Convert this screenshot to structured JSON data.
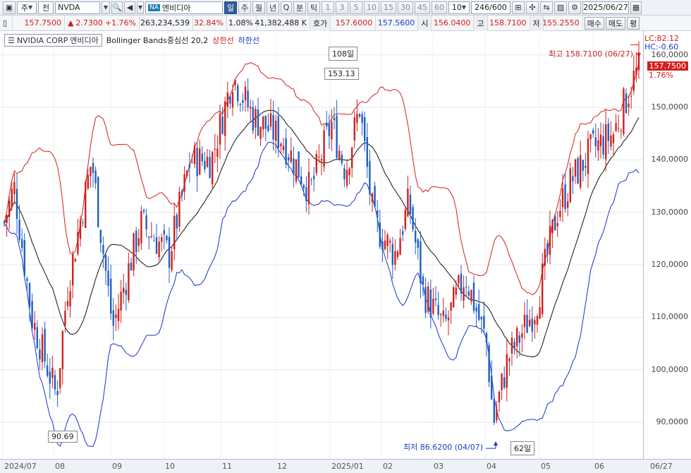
{
  "toolbar": {
    "mode_options": [
      "주",
      "전"
    ],
    "symbol": "NVDA",
    "na_badge": "NA",
    "name": "엔비디아",
    "periods": [
      "일",
      "주",
      "월",
      "년",
      "Q",
      "분",
      "틱"
    ],
    "active_period": "일",
    "intervals": [
      "1",
      "3",
      "5",
      "10",
      "15",
      "30",
      "45",
      "60",
      "10"
    ],
    "count": "246",
    "count_total": "/600",
    "date": "2025/06/27"
  },
  "quote": {
    "price": "157.7500",
    "change": "2.7300",
    "change_pct": "+1.76%",
    "volume": "263,234,539",
    "vol_ratio": "32.84%",
    "turnover_pct": "1.08%",
    "amount": "41,382,488 K",
    "bid_label": "호가",
    "bid": "157.6000",
    "ask": "157.5600",
    "open_label": "시",
    "open": "156.0400",
    "high_label": "고",
    "high": "158.7100",
    "low_label": "저",
    "low": "155.2550",
    "buy_label": "매수",
    "sell_label": "매도",
    "avg_label": "평"
  },
  "legend": {
    "company": "NVIDIA CORP",
    "name": "엔비디아",
    "indicator": "Bollinger Bands중심선 20,2",
    "upper": "상한선",
    "lower": "하한선"
  },
  "annotations": {
    "high_label": "최고 158.7100 (06/27)",
    "low_label": "최저 86.6200 (04/07)",
    "lc": "LC:82.12",
    "hc": "HC:-0.60",
    "peak_days": "108일",
    "peak_value": "153.13",
    "trough_value": "90.69",
    "low_days": "62일",
    "current_price": "157.7500",
    "current_pct": "1.76%"
  },
  "colors": {
    "up": "#d1201d",
    "down": "#1f5fc4",
    "upper_band": "#d1201d",
    "lower_band": "#1a2fd0",
    "middle_band": "#111111"
  },
  "chart_data": {
    "type": "candlestick",
    "title": "NVIDIA CORP 엔비디아",
    "indicator": "Bollinger Bands 20,2",
    "y_ticks": [
      "160,0000",
      "150,0000",
      "140,0000",
      "130,0000",
      "120,0000",
      "110,0000",
      "100,0000",
      "90,0000"
    ],
    "x_ticks": [
      "2024/07",
      "08",
      "09",
      "10",
      "11",
      "12",
      "2025/01",
      "02",
      "03",
      "04",
      "05",
      "06",
      "06/27"
    ],
    "ylim": [
      83,
      164
    ],
    "close_path_months": [
      {
        "month": "2024/07",
        "close": 117
      },
      {
        "month": "08",
        "close": 119
      },
      {
        "month": "09",
        "close": 121
      },
      {
        "month": "10",
        "close": 132
      },
      {
        "month": "11",
        "close": 138
      },
      {
        "month": "12",
        "close": 134
      },
      {
        "month": "2025/01",
        "close": 120
      },
      {
        "month": "02",
        "close": 124
      },
      {
        "month": "03",
        "close": 108
      },
      {
        "month": "04",
        "close": 108
      },
      {
        "month": "05",
        "close": 135
      },
      {
        "month": "06",
        "close": 157.75
      }
    ],
    "highest": {
      "value": 158.71,
      "date": "06/27"
    },
    "lowest": {
      "value": 86.62,
      "date": "04/07"
    }
  }
}
